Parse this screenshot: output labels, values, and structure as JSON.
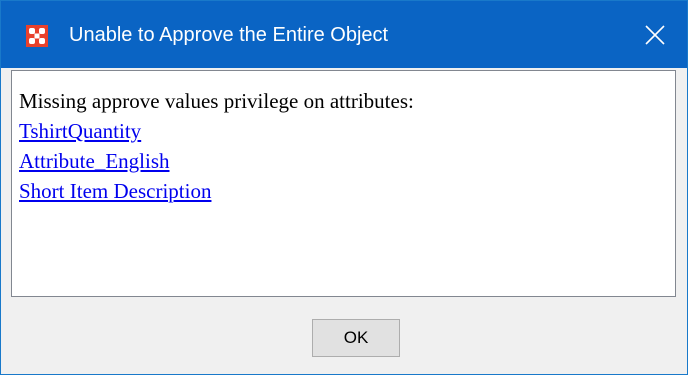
{
  "dialog": {
    "title": "Unable to Approve the Entire Object",
    "app_icon": "app-logo-icon",
    "close_icon": "close-icon",
    "message": "Missing approve values privilege on attributes:",
    "attribute_links": [
      "TshirtQuantity",
      "Attribute_English",
      "Short Item Description"
    ],
    "ok_label": "OK"
  },
  "colors": {
    "titlebar": "#0a64c4",
    "app_icon": "#e8412c",
    "link": "#0000ee",
    "window_background": "#f0f0f0"
  }
}
